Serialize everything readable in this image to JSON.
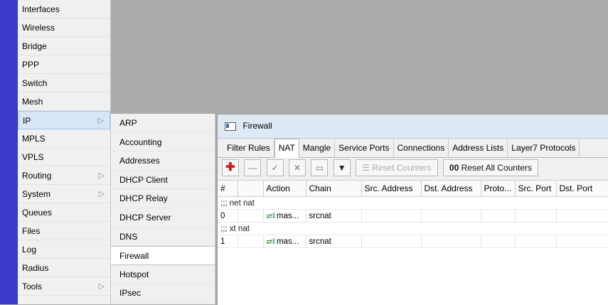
{
  "main_menu": [
    {
      "label": "Interfaces",
      "arrow": false
    },
    {
      "label": "Wireless",
      "arrow": false
    },
    {
      "label": "Bridge",
      "arrow": false
    },
    {
      "label": "PPP",
      "arrow": false
    },
    {
      "label": "Switch",
      "arrow": false
    },
    {
      "label": "Mesh",
      "arrow": false
    },
    {
      "label": "IP",
      "arrow": true,
      "active": true
    },
    {
      "label": "MPLS",
      "arrow": false
    },
    {
      "label": "VPLS",
      "arrow": false
    },
    {
      "label": "Routing",
      "arrow": true
    },
    {
      "label": "System",
      "arrow": true
    },
    {
      "label": "Queues",
      "arrow": false
    },
    {
      "label": "Files",
      "arrow": false
    },
    {
      "label": "Log",
      "arrow": false
    },
    {
      "label": "Radius",
      "arrow": false
    },
    {
      "label": "Tools",
      "arrow": true
    }
  ],
  "menu_arrow_glyph": "▷",
  "ip_submenu": [
    {
      "label": "ARP"
    },
    {
      "label": "Accounting"
    },
    {
      "label": "Addresses"
    },
    {
      "label": "DHCP Client"
    },
    {
      "label": "DHCP Relay"
    },
    {
      "label": "DHCP Server"
    },
    {
      "label": "DNS"
    },
    {
      "label": "Firewall",
      "active": true
    },
    {
      "label": "Hotspot"
    },
    {
      "label": "IPsec"
    }
  ],
  "window": {
    "title": "Firewall",
    "tabs": [
      "Filter Rules",
      "NAT",
      "Mangle",
      "Service Ports",
      "Connections",
      "Address Lists",
      "Layer7 Protocols"
    ],
    "active_tab": "NAT",
    "toolbar": {
      "add": "✚",
      "remove": "—",
      "enable": "✓",
      "disable": "✕",
      "comment": "▭",
      "filter": "▼",
      "reset_counters_icon": "☰",
      "reset_counters": "Reset Counters",
      "reset_all_icon": "00",
      "reset_all_counters": "Reset All Counters"
    },
    "columns": [
      "#",
      "",
      "Action",
      "Chain",
      "Src. Address",
      "Dst. Address",
      "Proto...",
      "Src. Port",
      "Dst. Port"
    ],
    "rows": [
      {
        "comment": ";;; net nat"
      },
      {
        "num": "0",
        "action_icon": "⇄‖",
        "action": "mas...",
        "chain": "srcnat"
      },
      {
        "comment": ";;; xt nat"
      },
      {
        "num": "1",
        "action_icon": "⇄‖",
        "action": "mas...",
        "chain": "srcnat"
      }
    ]
  }
}
